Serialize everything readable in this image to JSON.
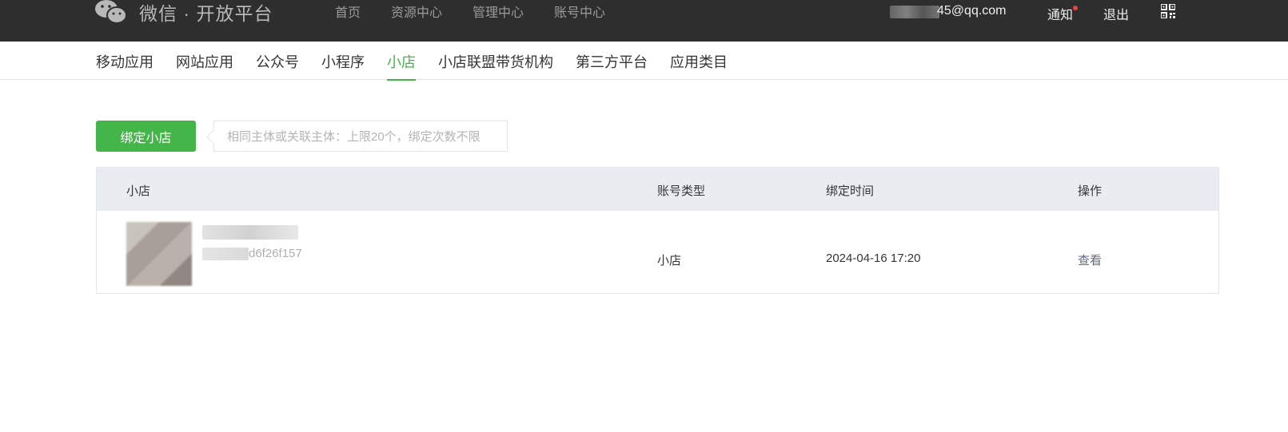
{
  "header": {
    "brand": "微信 · 开放平台",
    "nav": [
      "首页",
      "资源中心",
      "管理中心",
      "账号中心"
    ],
    "email_suffix": "45@qq.com",
    "notice": "通知",
    "logout": "退出"
  },
  "subnav": {
    "items": [
      "移动应用",
      "网站应用",
      "公众号",
      "小程序",
      "小店",
      "小店联盟带货机构",
      "第三方平台",
      "应用类目"
    ],
    "active": "小店"
  },
  "toolbar": {
    "bind_label": "绑定小店",
    "tip": "相同主体或关联主体：上限20个，绑定次数不限"
  },
  "table": {
    "headers": [
      "小店",
      "账号类型",
      "绑定时间",
      "操作"
    ],
    "rows": [
      {
        "id_suffix": "d6f26f157",
        "type": "小店",
        "bind_time": "2024-04-16 17:20",
        "action": "查看"
      }
    ]
  },
  "colors": {
    "accent": "#44b549",
    "link": "#576b95",
    "topbar": "#2e2e2e",
    "notice_dot": "#e64340"
  }
}
